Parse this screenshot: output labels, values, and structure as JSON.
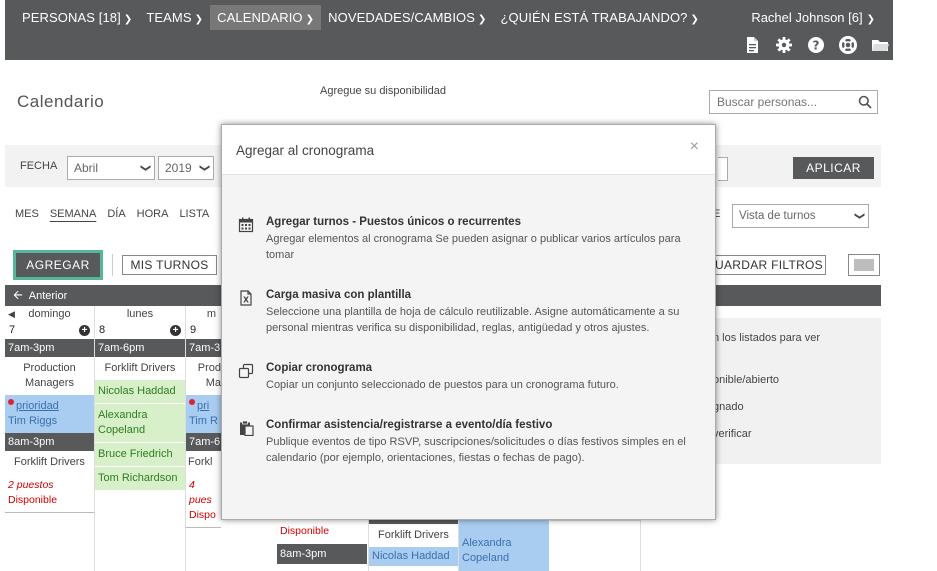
{
  "nav": {
    "items": [
      {
        "label": "PERSONAS [18]",
        "active": false
      },
      {
        "label": "TEAMS",
        "active": false
      },
      {
        "label": "CALENDARIO",
        "active": true
      },
      {
        "label": "NOVEDADES/CAMBIOS",
        "active": false
      },
      {
        "label": "¿QUIÉN ESTÁ TRABAJANDO?",
        "active": false
      }
    ],
    "user": "Rachel Johnson [6]",
    "icons": [
      "document-icon",
      "gear-icon",
      "help-icon",
      "lifebuoy-icon",
      "folder-icon"
    ]
  },
  "header": {
    "title": "Calendario",
    "availability": "Agregue su disponibilidad",
    "search_placeholder": "Buscar personas..."
  },
  "filters": {
    "fecha_label": "FECHA",
    "month": "Abril",
    "year": "2019",
    "apply": "APLICAR"
  },
  "views": {
    "tabs": [
      "MES",
      "SEMANA",
      "DÍA",
      "HORA",
      "LISTA"
    ],
    "active": "SEMANA",
    "partial_label": "E",
    "view_select": "Vista de turnos"
  },
  "actions": {
    "agregar": "AGREGAR",
    "mis_turnos": "MIS TURNOS",
    "guardar_filtros": "UARDAR FILTROS"
  },
  "calendar": {
    "anterior": "Anterior",
    "day_headers": [
      "domingo",
      "lunes",
      "m"
    ],
    "day_numbers": [
      "7",
      "8",
      "9"
    ],
    "col_sun": {
      "shift1": "7am-3pm",
      "pos1": "Production Managers",
      "pin_label": "prioridad",
      "person": "Tim Riggs",
      "shift2": "8am-3pm",
      "pos2": "Forklift Drivers",
      "red1": "2 puestos",
      "red2": "Disponible"
    },
    "col_mon": {
      "shift1": "7am-6pm",
      "pos1": "Forklift Drivers",
      "people": [
        "Nicolas Haddad",
        "Alexandra Copeland",
        "Bruce Friedrich",
        "Tom Richardson"
      ]
    },
    "col_tue": {
      "shift1": "7am-3",
      "pos1a": "Prod",
      "pos1b": "Ma",
      "pin_label": "pri",
      "person": "Tim R",
      "shift2": "7am-6",
      "pos2": "Forkl",
      "red1": "4 pues",
      "red2": "Dispo"
    },
    "lower": {
      "disponible": "Disponible",
      "shift": "8am-3pm",
      "forklift": "Forklift Drivers",
      "nicolas": "Nicolas Haddad",
      "alexandra": "Alexandra Copeland"
    },
    "side_panel": {
      "line1": "n los listados para ver",
      "line2": "onible/abierto",
      "line3": "gnado",
      "line4": "verificar"
    }
  },
  "modal": {
    "title": "Agregar al cronograma",
    "close": "×",
    "options": [
      {
        "icon": "calendar-icon",
        "title": "Agregar turnos - Puestos únicos o recurrentes",
        "desc": "Agregar elementos al cronograma Se pueden asignar o publicar varios artículos para tomar"
      },
      {
        "icon": "spreadsheet-icon",
        "title": "Carga masiva con plantilla",
        "desc": "Seleccione una plantilla de hoja de cálculo reutilizable. Asigne automáticamente a su personal mientras verifica su disponibilidad, reglas, antigüedad y otros ajustes."
      },
      {
        "icon": "copy-icon",
        "title": "Copiar cronograma",
        "desc": "Copiar un conjunto seleccionado de puestos para un cronograma futuro."
      },
      {
        "icon": "clipboard-icon",
        "title": "Confirmar asistencia/registrarse a evento/día festivo",
        "desc": "Publique eventos de tipo RSVP, suscripciones/solicitudes o días festivos simples en el calendario (por ejemplo, orientaciones, fiestas o fechas de pago)."
      }
    ]
  },
  "colors": {
    "nav_bg": "#58595b",
    "nav_active": "#787878",
    "accent_border": "#55b79a",
    "assigned_green": "#d7f0c9",
    "open_blue": "#a9cdf0",
    "available_red": "#cc0000"
  }
}
